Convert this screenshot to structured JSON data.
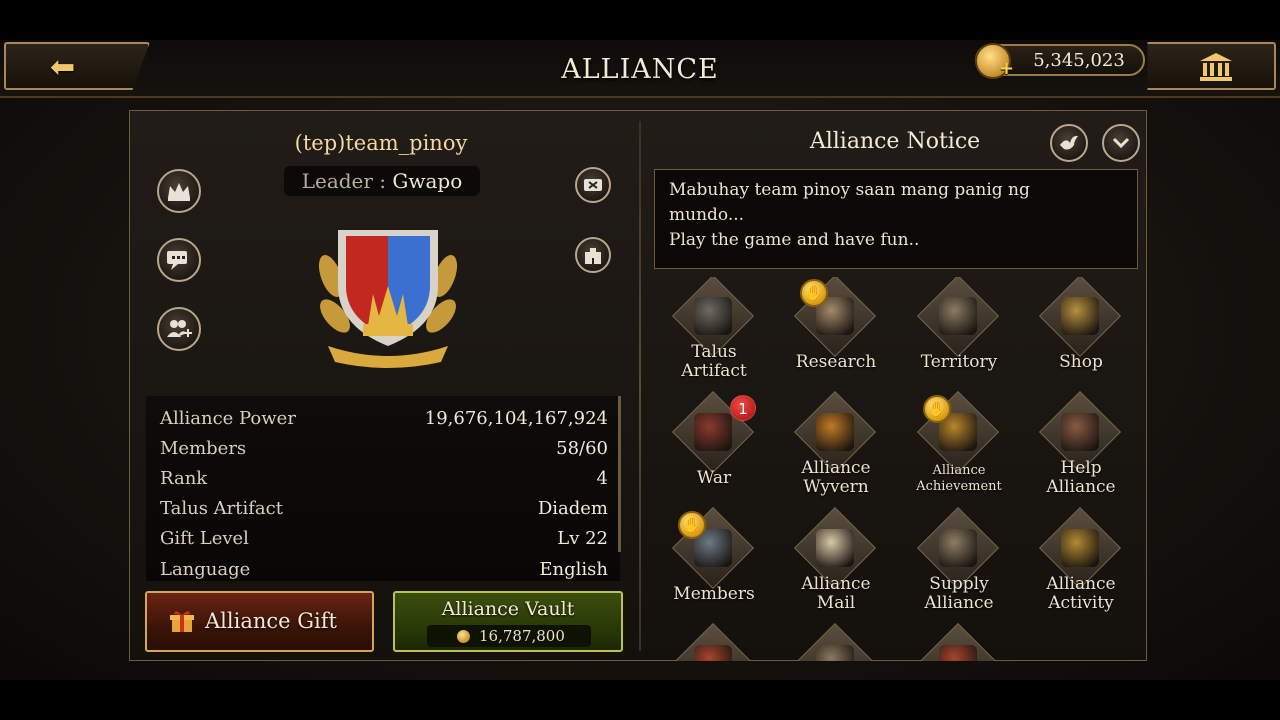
{
  "header": {
    "title": "ALLIANCE",
    "gold_amount": "5,345,023",
    "gold_plus": "+"
  },
  "alliance": {
    "name": "(tep)team_pinoy",
    "leader_label": "Leader",
    "leader_sep": " : ",
    "leader_name": "Gwapo"
  },
  "stats": [
    {
      "label": "Alliance Power",
      "value": "19,676,104,167,924"
    },
    {
      "label": "Members",
      "value": "58/60"
    },
    {
      "label": "Rank",
      "value": "4"
    },
    {
      "label": "Talus Artifact",
      "value": "Diadem"
    },
    {
      "label": "Gift Level",
      "value": "Lv 22"
    },
    {
      "label": "Language",
      "value": "English"
    }
  ],
  "buttons": {
    "gift_label": "Alliance Gift",
    "vault_label": "Alliance Vault",
    "vault_amount": "16,787,800"
  },
  "notice": {
    "title": "Alliance Notice",
    "lines": [
      "Mabuhay team pinoy saan mang panig ng",
      "mundo...",
      "Play the game and have fun.."
    ]
  },
  "features": [
    {
      "name": "talus-artifact",
      "line1": "Talus",
      "line2": "Artifact",
      "icon": "dragon-icon",
      "color": "#6f6a63"
    },
    {
      "name": "research",
      "line1": "Research",
      "line2": "",
      "icon": "book-icon",
      "color": "#a58a6a",
      "thumb": true
    },
    {
      "name": "territory",
      "line1": "Territory",
      "line2": "",
      "icon": "castle-icon",
      "color": "#8b7b62"
    },
    {
      "name": "shop",
      "line1": "Shop",
      "line2": "",
      "icon": "treasure-chest-icon",
      "color": "#b8903e"
    },
    {
      "name": "war",
      "line1": "War",
      "line2": "",
      "icon": "crossed-swords-icon",
      "color": "#8a3a2e",
      "count": "1"
    },
    {
      "name": "alliance-wyvern",
      "line1": "Alliance",
      "line2": "Wyvern",
      "icon": "wyvern-icon",
      "color": "#c07a24"
    },
    {
      "name": "alliance-achievement",
      "line1": "Alliance",
      "line2": "Achievement",
      "icon": "medal-icon",
      "color": "#b8862c",
      "thumb": true,
      "small": true
    },
    {
      "name": "help-alliance",
      "line1": "Help",
      "line2": "Alliance",
      "icon": "gauntlet-icon",
      "color": "#8a5a44"
    },
    {
      "name": "members",
      "line1": "Members",
      "line2": "",
      "icon": "members-icon",
      "color": "#6d7a86",
      "thumb": true
    },
    {
      "name": "alliance-mail",
      "line1": "Alliance",
      "line2": "Mail",
      "icon": "letter-icon",
      "color": "#d8c8a8"
    },
    {
      "name": "supply-alliance",
      "line1": "Supply",
      "line2": "Alliance",
      "icon": "cart-icon",
      "color": "#8e7d63"
    },
    {
      "name": "alliance-activity",
      "line1": "Alliance",
      "line2": "Activity",
      "icon": "trophy-icon",
      "color": "#b28a32"
    },
    {
      "name": "partial-1",
      "line1": "",
      "line2": "",
      "icon": "envelope-red-icon",
      "color": "#a8462e"
    },
    {
      "name": "partial-2",
      "line1": "",
      "line2": "",
      "icon": "tool-icon",
      "color": "#8a7a60"
    },
    {
      "name": "partial-3",
      "line1": "",
      "line2": "",
      "icon": "chest-red-icon",
      "color": "#a8462e"
    }
  ],
  "colors": {
    "accent_gold": "#d6a456",
    "gift_red": "#6a2413",
    "vault_green": "#3c4e0e",
    "badge_red": "#d0201f"
  }
}
